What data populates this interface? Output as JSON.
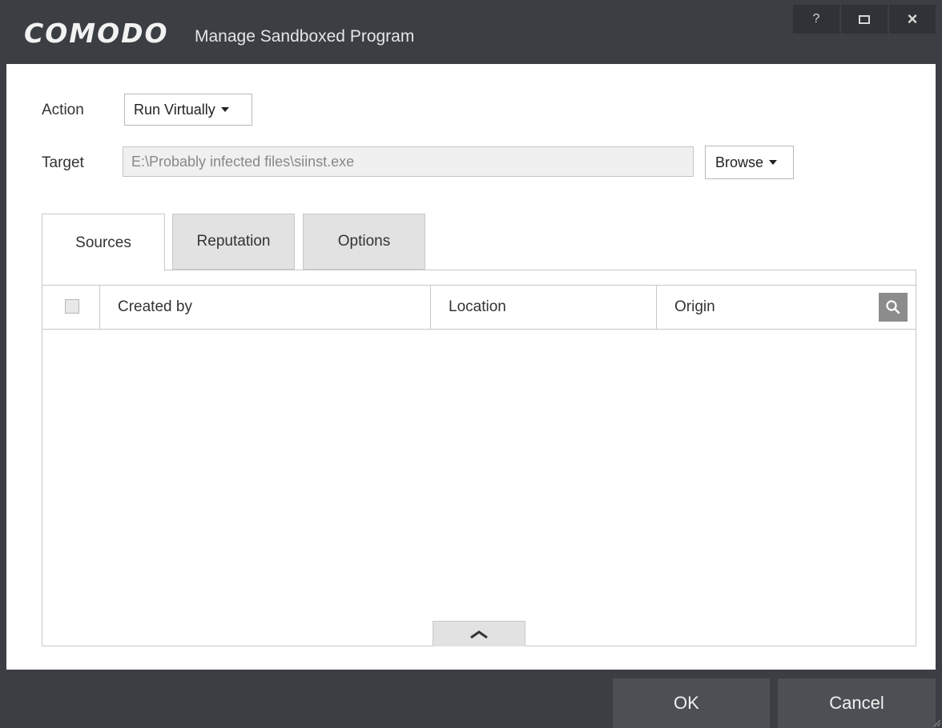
{
  "window": {
    "brand": "COMODO",
    "title": "Manage Sandboxed Program",
    "help_label": "?"
  },
  "form": {
    "action_label": "Action",
    "action_value": "Run Virtually",
    "target_label": "Target",
    "target_value": "E:\\Probably infected files\\siinst.exe",
    "browse_label": "Browse"
  },
  "tabs": [
    {
      "label": "Sources",
      "active": true
    },
    {
      "label": "Reputation",
      "active": false
    },
    {
      "label": "Options",
      "active": false
    }
  ],
  "table": {
    "columns": [
      "Created by",
      "Location",
      "Origin"
    ],
    "rows": []
  },
  "footer": {
    "ok_label": "OK",
    "cancel_label": "Cancel"
  },
  "colors": {
    "chrome": "#3b3e43",
    "footer_button": "#4c5055",
    "search_button": "#8c8c8c"
  },
  "icons": [
    "help-icon",
    "maximize-icon",
    "close-icon",
    "dropdown-caret-icon",
    "search-icon",
    "chevron-up-icon",
    "resize-grip-icon"
  ]
}
